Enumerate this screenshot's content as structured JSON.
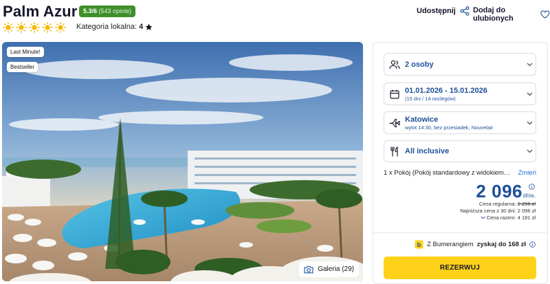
{
  "hotel": {
    "name": "Palm Azur",
    "rating_score": "5.3/6",
    "rating_count": "(543 opinie)",
    "suns": 5,
    "local_category_label": "Kategoria lokalna:",
    "local_category_value": "4"
  },
  "header_actions": {
    "share_label": "Udostępnij",
    "favorite_label": "Dodaj do ulubionych"
  },
  "photo": {
    "tags": [
      "Last Minute!",
      "Bestseller"
    ],
    "gallery_label": "Galeria (29)"
  },
  "booking": {
    "persons": "2 osoby",
    "dates": "01.01.2026 - 15.01.2026",
    "dates_sub": "(15 dni / 14 noclegów)",
    "departure": "Katowice",
    "departure_sub": "wylot 14:30, bez przesiadek, Nouvelair",
    "board": "All inclusive",
    "room_text": "1 x Pokój  (Pokój standardowy z widokiem na...",
    "room_change": "Zmień",
    "price": "2 096",
    "price_unit": "zł/os.",
    "regular_label": "Cena regularna:",
    "regular_price": "2 296 zł",
    "lowest_30_label": "Najniższa cena z 30 dni:",
    "lowest_30_price": "2 096 zł",
    "total_label": "Cena razem:",
    "total_price": "4 191 zł",
    "bumerang_prefix": "Z Bumerangiem",
    "bumerang_bold": "zyskaj do 168 zł",
    "reserve_label": "REZERWUJ"
  },
  "colors": {
    "brand_blue": "#1d4f9a",
    "rating_green": "#3e8f2a",
    "reserve_yellow": "#ffd21a",
    "sun_yellow": "#f5b800"
  }
}
